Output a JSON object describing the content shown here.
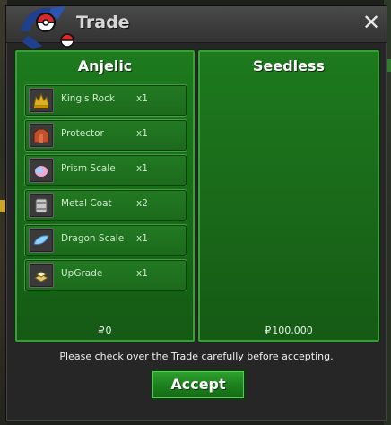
{
  "window": {
    "title": "Trade",
    "close_label": "✕",
    "logo_icon": "pokeball-emblem-icon"
  },
  "left_panel": {
    "player_name": "Anjelic",
    "money_symbol": "₽",
    "money": "0",
    "items": [
      {
        "name": "King's Rock",
        "qty": "x1",
        "icon": "kings-rock-icon"
      },
      {
        "name": "Protector",
        "qty": "x1",
        "icon": "protector-icon"
      },
      {
        "name": "Prism Scale",
        "qty": "x1",
        "icon": "prism-scale-icon"
      },
      {
        "name": "Metal Coat",
        "qty": "x2",
        "icon": "metal-coat-icon"
      },
      {
        "name": "Dragon Scale",
        "qty": "x1",
        "icon": "dragon-scale-icon"
      },
      {
        "name": "UpGrade",
        "qty": "x1",
        "icon": "upgrade-icon"
      }
    ]
  },
  "right_panel": {
    "player_name": "Seedless",
    "money_symbol": "₽",
    "money": "100,000",
    "items": []
  },
  "footer": {
    "notice": "Please check over the Trade carefully before accepting.",
    "accept_label": "Accept"
  },
  "colors": {
    "panel_green": "#1a6a1a",
    "panel_border": "#37a137",
    "window_bg": "#262626",
    "titlebar": "#3b3b3b"
  }
}
